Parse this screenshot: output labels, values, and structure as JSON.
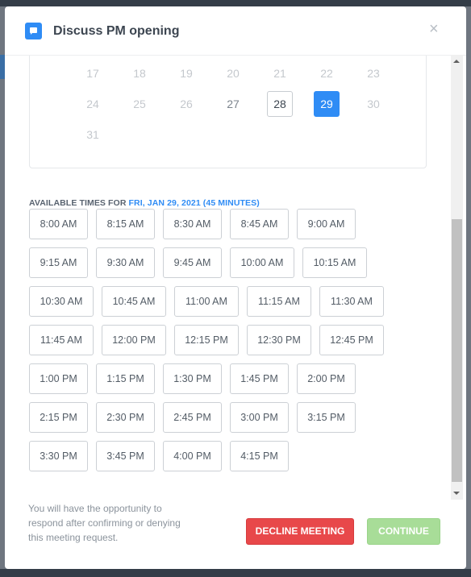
{
  "modal": {
    "title": "Discuss PM opening",
    "close_label": "×"
  },
  "calendar": {
    "weeks": [
      [
        {
          "label": "17",
          "state": "disabled"
        },
        {
          "label": "18",
          "state": "disabled"
        },
        {
          "label": "19",
          "state": "disabled"
        },
        {
          "label": "20",
          "state": "disabled"
        },
        {
          "label": "21",
          "state": "disabled"
        },
        {
          "label": "22",
          "state": "disabled"
        },
        {
          "label": "23",
          "state": "disabled"
        }
      ],
      [
        {
          "label": "24",
          "state": "disabled"
        },
        {
          "label": "25",
          "state": "disabled"
        },
        {
          "label": "26",
          "state": "disabled"
        },
        {
          "label": "27",
          "state": "available"
        },
        {
          "label": "28",
          "state": "today"
        },
        {
          "label": "29",
          "state": "selected"
        },
        {
          "label": "30",
          "state": "disabled"
        }
      ],
      [
        {
          "label": "31",
          "state": "disabled"
        }
      ]
    ]
  },
  "times": {
    "label_prefix": "AVAILABLE TIMES FOR ",
    "label_date": "FRI, JAN 29, 2021 (45 MINUTES)",
    "rows": [
      [
        "8:00 AM",
        "8:15 AM",
        "8:30 AM",
        "8:45 AM",
        "9:00 AM"
      ],
      [
        "9:15 AM",
        "9:30 AM",
        "9:45 AM",
        "10:00 AM",
        "10:15 AM"
      ],
      [
        "10:30 AM",
        "10:45 AM",
        "11:00 AM",
        "11:15 AM",
        "11:30 AM"
      ],
      [
        "11:45 AM",
        "12:00 PM",
        "12:15 PM",
        "12:30 PM",
        "12:45 PM"
      ],
      [
        "1:00 PM",
        "1:15 PM",
        "1:30 PM",
        "1:45 PM",
        "2:00 PM"
      ],
      [
        "2:15 PM",
        "2:30 PM",
        "2:45 PM",
        "3:00 PM",
        "3:15 PM"
      ],
      [
        "3:30 PM",
        "3:45 PM",
        "4:00 PM",
        "4:15 PM"
      ]
    ]
  },
  "footer": {
    "note": "You will have the opportunity to respond after confirming or denying this meeting request.",
    "decline_label": "DECLINE MEETING",
    "continue_label": "CONTINUE"
  },
  "colors": {
    "accent": "#2f8cf5",
    "decline": "#e8484a",
    "continue_disabled": "#a8dd98"
  }
}
